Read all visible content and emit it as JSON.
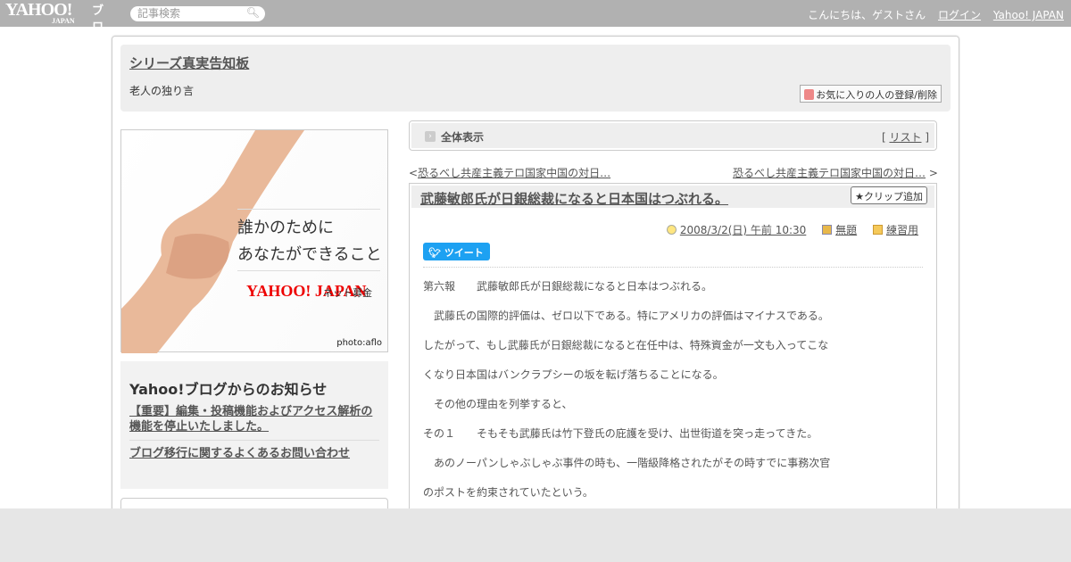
{
  "topbar": {
    "logo": "YAHOO!",
    "logo_sub": "JAPAN",
    "logo_blog": "ブログ",
    "search_placeholder": "記事検索",
    "greeting": "こんにちは、ゲストさん",
    "login": "ログイン",
    "yahoo_japan": "Yahoo! JAPAN"
  },
  "header": {
    "title": "シリーズ真実告知板",
    "description": "老人の独り言",
    "favorite_button": "お気に入りの人の登録/削除"
  },
  "banner": {
    "line1": "誰かのために",
    "line2": "あなたができること",
    "logo": "YAHOO! JAPAN",
    "service": "ネット募金",
    "credit": "photo:aflo"
  },
  "notice": {
    "title": "Yahoo!ブログからのお知らせ",
    "items": [
      "【重要】編集・投稿機能およびアクセス解析の機能を停止いたしました。",
      "ブログ移行に関するよくあるお問い合わせ"
    ]
  },
  "view_bar": {
    "label": "全体表示",
    "list_open": "[",
    "list_link": "リスト",
    "list_close": "]"
  },
  "nav": {
    "prev_arrow": "<",
    "prev": "恐るべし共産主義テロ国家中国の対日…",
    "next": "恐るべし共産主義テロ国家中国の対日…",
    "next_arrow": ">"
  },
  "post": {
    "title": "武藤敏郎氏が日銀総裁になると日本国はつぶれる。",
    "clip_button": "クリップ追加",
    "date": "2008/3/2(日) 午前 10:30",
    "category": "無題",
    "folder": "練習用",
    "tweet": "ツイート",
    "body": [
      "第六報　　武藤敏郎氏が日銀総裁になると日本はつぶれる。",
      "　武藤氏の国際的評価は、ゼロ以下である。特にアメリカの評価はマイナスである。",
      "したがって、もし武藤氏が日銀総裁になると在任中は、特殊資金が一文も入ってこな",
      "くなり日本国はバンクラプシーの坂を転げ落ちることになる。",
      "　その他の理由を列挙すると、",
      "その１　　そもそも武藤氏は竹下登氏の庇護を受け、出世街道を突っ走ってきた。",
      "　あのノーパンしゃぶしゃぶ事件の時も、一階級降格されたがその時すでに事務次官",
      "のポストを約束されていたという。"
    ]
  }
}
